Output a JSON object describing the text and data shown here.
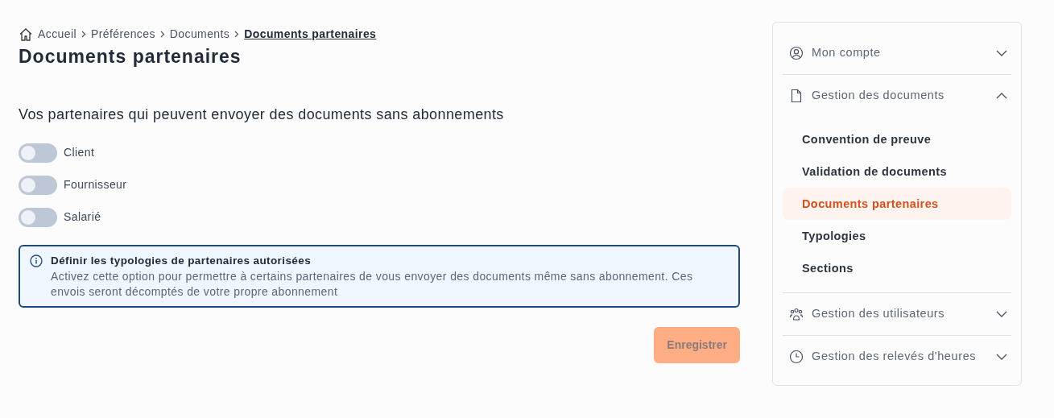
{
  "breadcrumb": [
    {
      "label": "Accueil",
      "kind": "home",
      "current": false
    },
    {
      "label": "Préférences",
      "kind": "link",
      "current": false
    },
    {
      "label": "Documents",
      "kind": "link",
      "current": false
    },
    {
      "label": "Documents partenaires",
      "kind": "link",
      "current": true
    }
  ],
  "title": "Documents partenaires",
  "subtitle": "Vos partenaires qui peuvent envoyer des documents sans abonnements",
  "toggles": [
    {
      "label": "Client",
      "checked": false
    },
    {
      "label": "Fournisseur",
      "checked": false
    },
    {
      "label": "Salarié",
      "checked": false
    }
  ],
  "info": {
    "title": "Définir les typologies de partenaires autorisées",
    "text": "Activez cette option pour permettre à certains partenaires de vous envoyer des documents même sans abonnement. Ces envois seront décomptés de votre propre abonnement"
  },
  "save_button": {
    "label": "Enregistrer",
    "disabled": true
  },
  "sidebar": [
    {
      "label": "Mon compte",
      "kind": "user",
      "expanded": false
    },
    {
      "label": "Gestion des documents",
      "kind": "document",
      "expanded": true,
      "children": [
        {
          "label": "Convention de preuve",
          "selected": false
        },
        {
          "label": "Validation de documents",
          "selected": false
        },
        {
          "label": "Documents partenaires",
          "selected": true
        },
        {
          "label": "Typologies",
          "selected": false
        },
        {
          "label": "Sections",
          "selected": false
        }
      ]
    },
    {
      "label": "Gestion des utilisateurs",
      "kind": "users",
      "expanded": false
    },
    {
      "label": "Gestion des relevés d'heures",
      "kind": "clock",
      "expanded": false
    }
  ]
}
